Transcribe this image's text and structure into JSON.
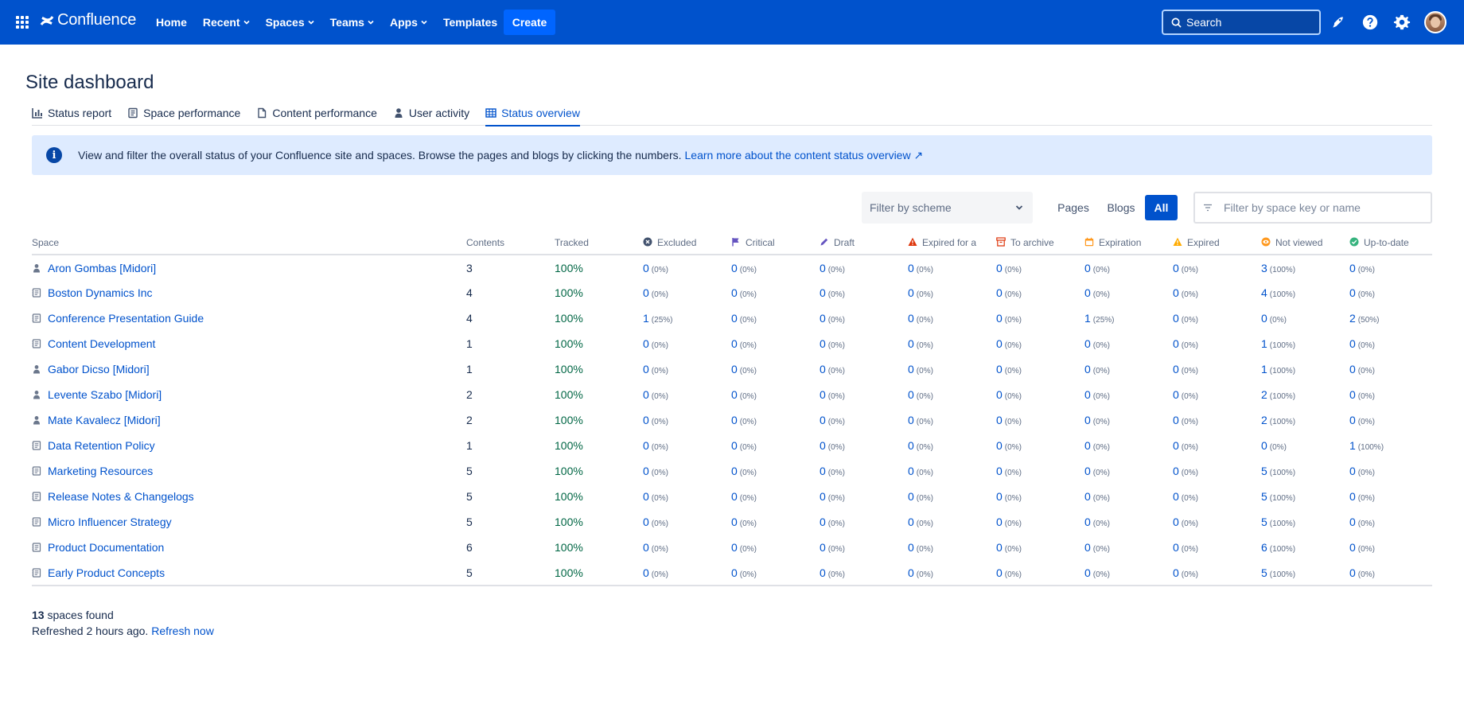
{
  "nav": {
    "logo": "Confluence",
    "links": [
      {
        "label": "Home",
        "dropdown": false
      },
      {
        "label": "Recent",
        "dropdown": true
      },
      {
        "label": "Spaces",
        "dropdown": true
      },
      {
        "label": "Teams",
        "dropdown": true
      },
      {
        "label": "Apps",
        "dropdown": true
      },
      {
        "label": "Templates",
        "dropdown": false
      }
    ],
    "create": "Create",
    "search_placeholder": "Search",
    "icons": [
      "notifications-icon",
      "help-icon",
      "settings-icon"
    ]
  },
  "page": {
    "title": "Site dashboard",
    "tabs": [
      {
        "label": "Status report",
        "icon": "bar-chart-icon",
        "active": false
      },
      {
        "label": "Space performance",
        "icon": "space-icon",
        "active": false
      },
      {
        "label": "Content performance",
        "icon": "page-icon",
        "active": false
      },
      {
        "label": "User activity",
        "icon": "person-icon",
        "active": false
      },
      {
        "label": "Status overview",
        "icon": "table-icon",
        "active": true
      }
    ]
  },
  "banner": {
    "text": "View and filter the overall status of your Confluence site and spaces. Browse the pages and blogs by clicking the numbers.",
    "link": "Learn more about the content status overview ↗"
  },
  "filters": {
    "scheme_placeholder": "Filter by scheme",
    "segments": [
      "Pages",
      "Blogs",
      "All"
    ],
    "active_segment": "All",
    "space_placeholder": "Filter by space key or name"
  },
  "table": {
    "headers": {
      "space": "Space",
      "contents": "Contents",
      "tracked": "Tracked",
      "excluded": "Excluded",
      "critical": "Critical",
      "draft": "Draft",
      "expired_for": "Expired for a",
      "to_archive": "To archive",
      "expiration": "Expiration",
      "expired": "Expired",
      "not_viewed": "Not viewed",
      "up_to_date": "Up-to-date"
    },
    "rows": [
      {
        "space": "Aron Gombas [Midori]",
        "type": "person",
        "contents": "3",
        "tracked": "100%",
        "cells": [
          [
            "0",
            "(0%)"
          ],
          [
            "0",
            "(0%)"
          ],
          [
            "0",
            "(0%)"
          ],
          [
            "0",
            "(0%)"
          ],
          [
            "0",
            "(0%)"
          ],
          [
            "0",
            "(0%)"
          ],
          [
            "0",
            "(0%)"
          ],
          [
            "3",
            "(100%)"
          ],
          [
            "0",
            "(0%)"
          ]
        ]
      },
      {
        "space": "Boston Dynamics Inc",
        "type": "space",
        "contents": "4",
        "tracked": "100%",
        "cells": [
          [
            "0",
            "(0%)"
          ],
          [
            "0",
            "(0%)"
          ],
          [
            "0",
            "(0%)"
          ],
          [
            "0",
            "(0%)"
          ],
          [
            "0",
            "(0%)"
          ],
          [
            "0",
            "(0%)"
          ],
          [
            "0",
            "(0%)"
          ],
          [
            "4",
            "(100%)"
          ],
          [
            "0",
            "(0%)"
          ]
        ]
      },
      {
        "space": "Conference Presentation Guide",
        "type": "space",
        "contents": "4",
        "tracked": "100%",
        "cells": [
          [
            "1",
            "(25%)"
          ],
          [
            "0",
            "(0%)"
          ],
          [
            "0",
            "(0%)"
          ],
          [
            "0",
            "(0%)"
          ],
          [
            "0",
            "(0%)"
          ],
          [
            "1",
            "(25%)"
          ],
          [
            "0",
            "(0%)"
          ],
          [
            "0",
            "(0%)"
          ],
          [
            "2",
            "(50%)"
          ]
        ]
      },
      {
        "space": "Content Development",
        "type": "space",
        "contents": "1",
        "tracked": "100%",
        "cells": [
          [
            "0",
            "(0%)"
          ],
          [
            "0",
            "(0%)"
          ],
          [
            "0",
            "(0%)"
          ],
          [
            "0",
            "(0%)"
          ],
          [
            "0",
            "(0%)"
          ],
          [
            "0",
            "(0%)"
          ],
          [
            "0",
            "(0%)"
          ],
          [
            "1",
            "(100%)"
          ],
          [
            "0",
            "(0%)"
          ]
        ]
      },
      {
        "space": "Gabor Dicso [Midori]",
        "type": "person",
        "contents": "1",
        "tracked": "100%",
        "cells": [
          [
            "0",
            "(0%)"
          ],
          [
            "0",
            "(0%)"
          ],
          [
            "0",
            "(0%)"
          ],
          [
            "0",
            "(0%)"
          ],
          [
            "0",
            "(0%)"
          ],
          [
            "0",
            "(0%)"
          ],
          [
            "0",
            "(0%)"
          ],
          [
            "1",
            "(100%)"
          ],
          [
            "0",
            "(0%)"
          ]
        ]
      },
      {
        "space": "Levente Szabo [Midori]",
        "type": "person",
        "contents": "2",
        "tracked": "100%",
        "cells": [
          [
            "0",
            "(0%)"
          ],
          [
            "0",
            "(0%)"
          ],
          [
            "0",
            "(0%)"
          ],
          [
            "0",
            "(0%)"
          ],
          [
            "0",
            "(0%)"
          ],
          [
            "0",
            "(0%)"
          ],
          [
            "0",
            "(0%)"
          ],
          [
            "2",
            "(100%)"
          ],
          [
            "0",
            "(0%)"
          ]
        ]
      },
      {
        "space": "Mate Kavalecz [Midori]",
        "type": "person",
        "contents": "2",
        "tracked": "100%",
        "cells": [
          [
            "0",
            "(0%)"
          ],
          [
            "0",
            "(0%)"
          ],
          [
            "0",
            "(0%)"
          ],
          [
            "0",
            "(0%)"
          ],
          [
            "0",
            "(0%)"
          ],
          [
            "0",
            "(0%)"
          ],
          [
            "0",
            "(0%)"
          ],
          [
            "2",
            "(100%)"
          ],
          [
            "0",
            "(0%)"
          ]
        ]
      },
      {
        "space": "Data Retention Policy",
        "type": "space",
        "contents": "1",
        "tracked": "100%",
        "cells": [
          [
            "0",
            "(0%)"
          ],
          [
            "0",
            "(0%)"
          ],
          [
            "0",
            "(0%)"
          ],
          [
            "0",
            "(0%)"
          ],
          [
            "0",
            "(0%)"
          ],
          [
            "0",
            "(0%)"
          ],
          [
            "0",
            "(0%)"
          ],
          [
            "0",
            "(0%)"
          ],
          [
            "1",
            "(100%)"
          ]
        ]
      },
      {
        "space": "Marketing Resources",
        "type": "space",
        "contents": "5",
        "tracked": "100%",
        "cells": [
          [
            "0",
            "(0%)"
          ],
          [
            "0",
            "(0%)"
          ],
          [
            "0",
            "(0%)"
          ],
          [
            "0",
            "(0%)"
          ],
          [
            "0",
            "(0%)"
          ],
          [
            "0",
            "(0%)"
          ],
          [
            "0",
            "(0%)"
          ],
          [
            "5",
            "(100%)"
          ],
          [
            "0",
            "(0%)"
          ]
        ]
      },
      {
        "space": "Release Notes & Changelogs",
        "type": "space",
        "contents": "5",
        "tracked": "100%",
        "cells": [
          [
            "0",
            "(0%)"
          ],
          [
            "0",
            "(0%)"
          ],
          [
            "0",
            "(0%)"
          ],
          [
            "0",
            "(0%)"
          ],
          [
            "0",
            "(0%)"
          ],
          [
            "0",
            "(0%)"
          ],
          [
            "0",
            "(0%)"
          ],
          [
            "5",
            "(100%)"
          ],
          [
            "0",
            "(0%)"
          ]
        ]
      },
      {
        "space": "Micro Influencer Strategy",
        "type": "space",
        "contents": "5",
        "tracked": "100%",
        "cells": [
          [
            "0",
            "(0%)"
          ],
          [
            "0",
            "(0%)"
          ],
          [
            "0",
            "(0%)"
          ],
          [
            "0",
            "(0%)"
          ],
          [
            "0",
            "(0%)"
          ],
          [
            "0",
            "(0%)"
          ],
          [
            "0",
            "(0%)"
          ],
          [
            "5",
            "(100%)"
          ],
          [
            "0",
            "(0%)"
          ]
        ]
      },
      {
        "space": "Product Documentation",
        "type": "space",
        "contents": "6",
        "tracked": "100%",
        "cells": [
          [
            "0",
            "(0%)"
          ],
          [
            "0",
            "(0%)"
          ],
          [
            "0",
            "(0%)"
          ],
          [
            "0",
            "(0%)"
          ],
          [
            "0",
            "(0%)"
          ],
          [
            "0",
            "(0%)"
          ],
          [
            "0",
            "(0%)"
          ],
          [
            "6",
            "(100%)"
          ],
          [
            "0",
            "(0%)"
          ]
        ]
      },
      {
        "space": "Early Product Concepts",
        "type": "space",
        "contents": "5",
        "tracked": "100%",
        "cells": [
          [
            "0",
            "(0%)"
          ],
          [
            "0",
            "(0%)"
          ],
          [
            "0",
            "(0%)"
          ],
          [
            "0",
            "(0%)"
          ],
          [
            "0",
            "(0%)"
          ],
          [
            "0",
            "(0%)"
          ],
          [
            "0",
            "(0%)"
          ],
          [
            "5",
            "(100%)"
          ],
          [
            "0",
            "(0%)"
          ]
        ]
      }
    ]
  },
  "footer": {
    "count": "13",
    "count_suffix": "spaces found",
    "refreshed": "Refreshed 2 hours ago.",
    "refresh_link": "Refresh now"
  },
  "colors": {
    "nav_bg": "#0052cc",
    "link": "#0052cc",
    "tracked": "#006644",
    "banner_bg": "#deebff"
  }
}
